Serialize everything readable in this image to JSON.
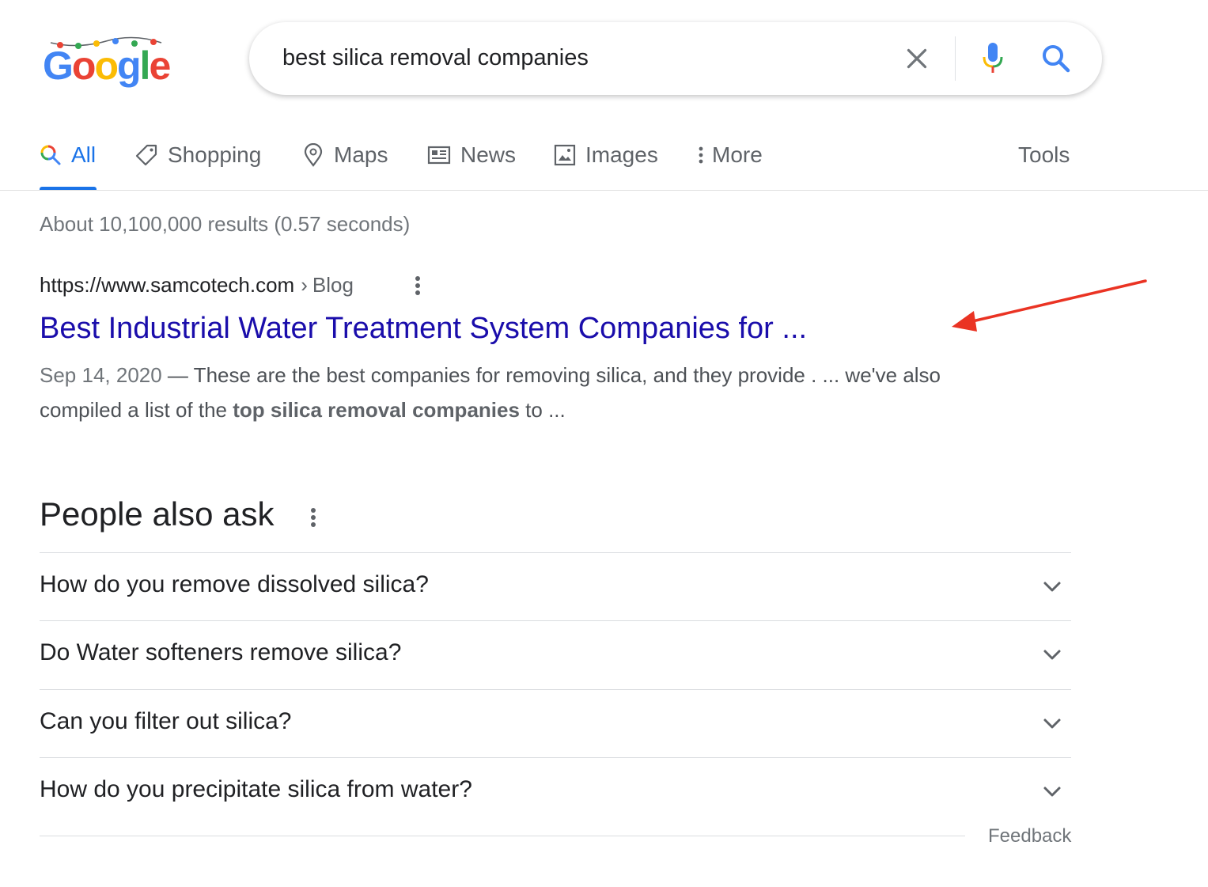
{
  "logo": {
    "text": "Google",
    "letters": [
      "G",
      "o",
      "o",
      "g",
      "l",
      "e"
    ],
    "colors": [
      "#4285f4",
      "#ea4335",
      "#fbbc05",
      "#4285f4",
      "#34a853",
      "#ea4335"
    ]
  },
  "search": {
    "query": "best silica removal companies"
  },
  "icons": {
    "clear": "close-icon",
    "mic": "microphone-icon",
    "search": "search-icon",
    "all": "search-icon",
    "shopping": "tag-icon",
    "maps": "map-pin-icon",
    "news": "newspaper-icon",
    "images": "image-icon",
    "more": "vertical-dots-icon",
    "chevron": "chevron-down-icon"
  },
  "tabs": [
    {
      "label": "All",
      "active": true
    },
    {
      "label": "Shopping"
    },
    {
      "label": "Maps"
    },
    {
      "label": "News"
    },
    {
      "label": "Images"
    },
    {
      "label": "More"
    }
  ],
  "tools_label": "Tools",
  "result_stats": "About 10,100,000 results (0.57 seconds)",
  "result": {
    "url": "https://www.samcotech.com",
    "separator": "›",
    "path": "Blog",
    "title": "Best Industrial Water Treatment System Companies for ...",
    "date": "Sep 14, 2020",
    "snippet_pre": " — These are the best companies for removing silica, and they provide . ... we've also compiled a list of the ",
    "snippet_bold": "top silica removal companies",
    "snippet_post": " to ..."
  },
  "annotation_arrow_color": "#ea3323",
  "people_also_ask": {
    "title": "People also ask",
    "questions": [
      "How do you remove dissolved silica?",
      "Do Water softeners remove silica?",
      "Can you filter out silica?",
      "How do you precipitate silica from water?"
    ]
  },
  "feedback_label": "Feedback",
  "colors": {
    "link": "#1a0dab",
    "accent": "#1a73e8",
    "muted": "#70757a"
  }
}
